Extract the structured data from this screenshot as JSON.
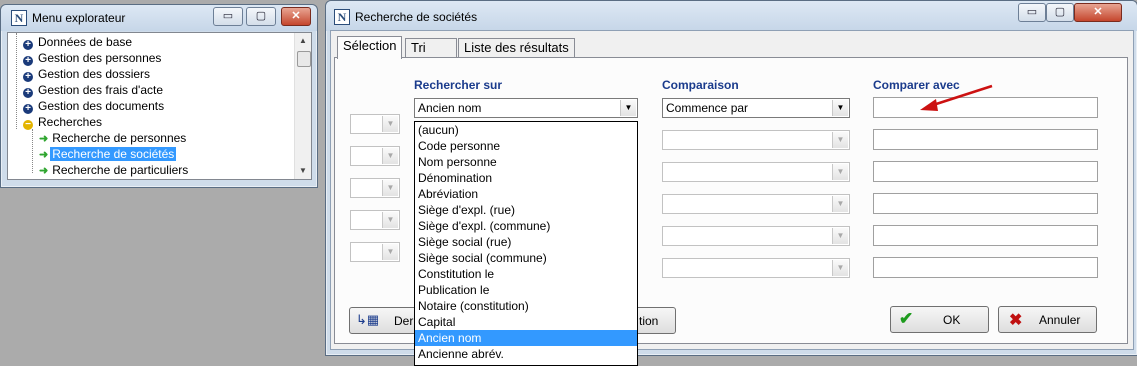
{
  "explorer": {
    "title": "Menu explorateur",
    "controls": {
      "minimize": "▭",
      "maximize": "▢",
      "close": "✕"
    },
    "tree": [
      {
        "label": "Données de base",
        "type": "folder"
      },
      {
        "label": "Gestion des personnes",
        "type": "folder"
      },
      {
        "label": "Gestion des dossiers",
        "type": "folder"
      },
      {
        "label": "Gestion des frais d'acte",
        "type": "folder"
      },
      {
        "label": "Gestion des documents",
        "type": "folder"
      },
      {
        "label": "Recherches",
        "type": "open-folder"
      },
      {
        "label": "Recherche de personnes",
        "type": "item"
      },
      {
        "label": "Recherche de sociétés",
        "type": "item",
        "selected": true
      },
      {
        "label": "Recherche de particuliers",
        "type": "item"
      }
    ]
  },
  "dialog": {
    "title": "Recherche de sociétés",
    "tabs": [
      {
        "label": "Sélection",
        "active": true
      },
      {
        "label": "Tri"
      },
      {
        "label": "Liste des résultats"
      }
    ],
    "headers": {
      "search_on": "Rechercher sur",
      "comparison": "Comparaison",
      "compare_with": "Comparer avec"
    },
    "row1": {
      "field": "Ancien nom",
      "comparison": "Commence par",
      "value": ""
    },
    "dropdown_options": [
      "(aucun)",
      "Code personne",
      "Nom personne",
      "Dénomination",
      "Abréviation",
      "Siège d'expl. (rue)",
      "Siège d'expl. (commune)",
      "Siège social (rue)",
      "Siège social (commune)",
      "Constitution le",
      "Publication le",
      "Notaire (constitution)",
      "Capital",
      "Ancien nom",
      "Ancienne abrév."
    ],
    "highlighted_option": "Ancien nom",
    "bottom_left_button_partial": "Der",
    "middle_button_partial": "tion",
    "ok_label": "OK",
    "cancel_label": "Annuler"
  },
  "colors": {
    "selection": "#3399ff",
    "header_text": "#1a3b8c",
    "annotation_arrow": "#cc1111"
  }
}
